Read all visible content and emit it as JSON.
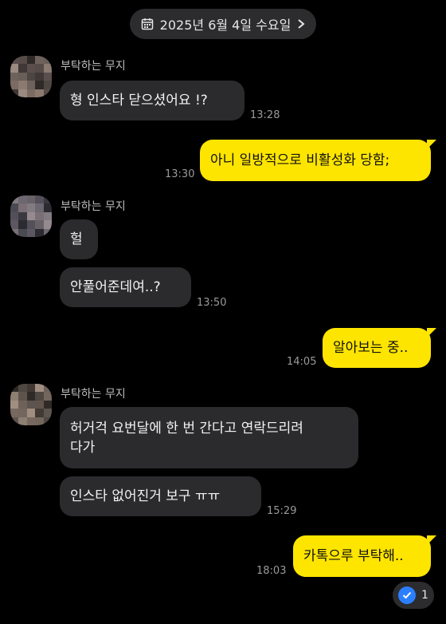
{
  "date_header": {
    "label": "2025년 6월 4일 수요일",
    "icon": "calendar-icon",
    "chevron": "chevron-right-icon"
  },
  "sender_name": "부탁하는 무지",
  "messages": [
    {
      "text": "형 인스타 닫으셨어요 !?",
      "time": "13:28",
      "from": "them"
    },
    {
      "text": "아니 일방적으로 비활성화 당함;",
      "time": "13:30",
      "from": "me"
    },
    {
      "text": "헐",
      "time": "",
      "from": "them"
    },
    {
      "text": "안풀어준데여..?",
      "time": "13:50",
      "from": "them"
    },
    {
      "text": "알아보는 중..",
      "time": "14:05",
      "from": "me"
    },
    {
      "text": "허거걱 요번달에 한 번 간다고 연락드리려\n다가",
      "time": "",
      "from": "them"
    },
    {
      "text": "인스타 없어진거 보구 ㅠㅠ",
      "time": "15:29",
      "from": "them"
    },
    {
      "text": "카톡으루 부탁해..",
      "time": "18:03",
      "from": "me"
    }
  ],
  "read_badge": {
    "count": "1",
    "icon": "check-circle-icon"
  },
  "colors": {
    "background": "#000000",
    "incoming_bubble": "#2b2b2d",
    "outgoing_bubble": "#fee500",
    "badge_blue": "#2b7fff"
  }
}
